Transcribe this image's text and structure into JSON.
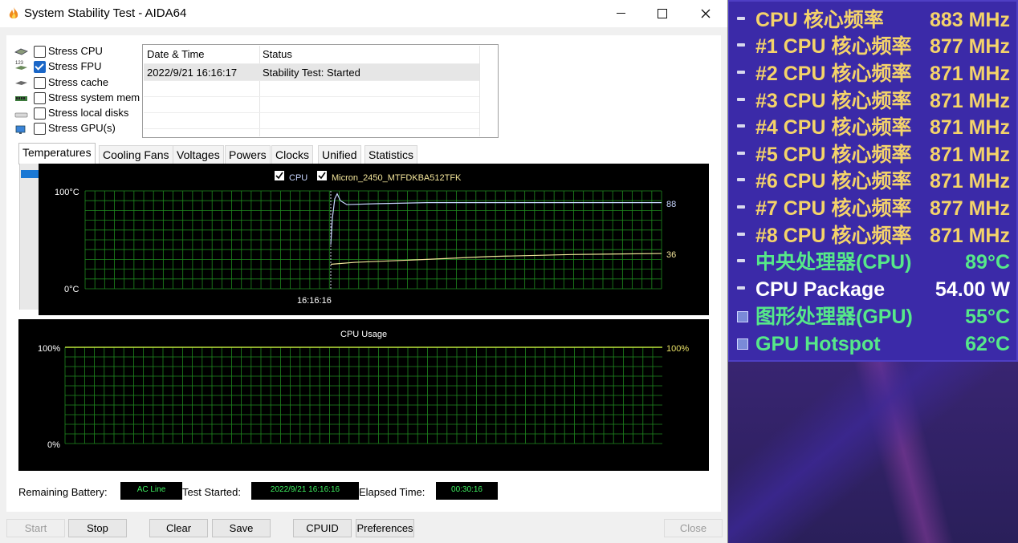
{
  "window": {
    "title": "System Stability Test - AIDA64"
  },
  "stress_options": [
    {
      "label": "Stress CPU",
      "checked": false
    },
    {
      "label": "Stress FPU",
      "checked": true
    },
    {
      "label": "Stress cache",
      "checked": false
    },
    {
      "label": "Stress system mem",
      "checked": false
    },
    {
      "label": "Stress local disks",
      "checked": false
    },
    {
      "label": "Stress GPU(s)",
      "checked": false
    }
  ],
  "log": {
    "columns": [
      "Date & Time",
      "Status"
    ],
    "rows": [
      {
        "datetime": "2022/9/21 16:16:17",
        "status": "Stability Test: Started"
      }
    ]
  },
  "tabs": [
    "Temperatures",
    "Cooling Fans",
    "Voltages",
    "Powers",
    "Clocks",
    "Unified",
    "Statistics"
  ],
  "temperature_graph": {
    "legend": [
      "CPU",
      "Micron_2450_MTFDKBA512TFK"
    ],
    "y_max_label": "100°C",
    "y_min_label": "0°C",
    "x_label": "16:16:16",
    "cpu_value": "88",
    "disk_value": "36",
    "colors": {
      "cpu": "#c8d6ff",
      "disk": "#f3e59a",
      "grid": "#1f8a1f"
    }
  },
  "cpu_usage_graph": {
    "title": "CPU Usage",
    "y_max_label": "100%",
    "y_min_label": "0%",
    "value_label": "100%",
    "colors": {
      "line": "#bde63a",
      "grid": "#1f8a1f"
    }
  },
  "footer": {
    "remaining_battery_label": "Remaining Battery:",
    "remaining_battery_value": "AC Line",
    "test_started_label": "Test Started:",
    "test_started_value": "2022/9/21 16:16:16",
    "elapsed_time_label": "Elapsed Time:",
    "elapsed_time_value": "00:30:16"
  },
  "buttons": {
    "start": "Start",
    "stop": "Stop",
    "clear": "Clear",
    "save": "Save",
    "cpuid": "CPUID",
    "preferences": "Preferences",
    "close": "Close"
  },
  "osd": [
    {
      "label": "CPU 核心频率",
      "value": "883 MHz",
      "color": "#f4d36a",
      "icon": "bullet-icon"
    },
    {
      "label": "#1 CPU 核心频率",
      "value": "877 MHz",
      "color": "#f4d36a",
      "icon": "bullet-icon"
    },
    {
      "label": "#2 CPU 核心频率",
      "value": "871 MHz",
      "color": "#f4d36a",
      "icon": "bullet-icon"
    },
    {
      "label": "#3 CPU 核心频率",
      "value": "871 MHz",
      "color": "#f4d36a",
      "icon": "bullet-icon"
    },
    {
      "label": "#4 CPU 核心频率",
      "value": "871 MHz",
      "color": "#f4d36a",
      "icon": "bullet-icon"
    },
    {
      "label": "#5 CPU 核心频率",
      "value": "871 MHz",
      "color": "#f4d36a",
      "icon": "bullet-icon"
    },
    {
      "label": "#6 CPU 核心频率",
      "value": "871 MHz",
      "color": "#f4d36a",
      "icon": "bullet-icon"
    },
    {
      "label": "#7 CPU 核心频率",
      "value": "877 MHz",
      "color": "#f4d36a",
      "icon": "bullet-icon"
    },
    {
      "label": "#8 CPU 核心频率",
      "value": "871 MHz",
      "color": "#f4d36a",
      "icon": "bullet-icon"
    },
    {
      "label": "中央处理器(CPU)",
      "value": "89°C",
      "color": "#56e889",
      "icon": "bullet-icon"
    },
    {
      "label": "CPU Package",
      "value": "54.00 W",
      "color": "#ffffff",
      "icon": "bullet-icon"
    },
    {
      "label": "图形处理器(GPU)",
      "value": "55°C",
      "color": "#56e889",
      "icon": "gpu-icon"
    },
    {
      "label": "GPU Hotspot",
      "value": "62°C",
      "color": "#56e889",
      "icon": "gpu-icon"
    }
  ]
}
